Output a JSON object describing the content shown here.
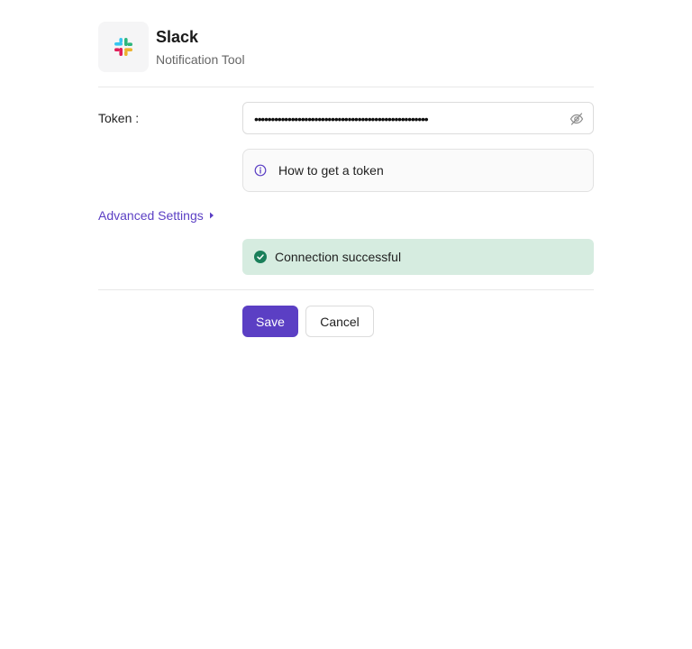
{
  "app": {
    "name": "Slack",
    "type": "Notification Tool",
    "logo_icon": "slack-logo",
    "logo_colors": [
      "#36c5f0",
      "#2eb67d",
      "#ecb22e",
      "#e01e5a"
    ]
  },
  "form": {
    "token_label": "Token :",
    "token_value": "••••••••••••••••••••••••••••••••••••••••••••••••••••",
    "token_visibility_icon": "eye-off-icon",
    "help_icon": "info-icon",
    "help_text": "How to get a token",
    "advanced_settings_label": "Advanced Settings",
    "advanced_icon": "caret-right-icon"
  },
  "status": {
    "icon": "check-circle-icon",
    "text": "Connection successful",
    "color": "#1a7f5a",
    "background": "#d6ece0"
  },
  "actions": {
    "save_label": "Save",
    "cancel_label": "Cancel"
  },
  "colors": {
    "accent": "#5b3fc4"
  }
}
